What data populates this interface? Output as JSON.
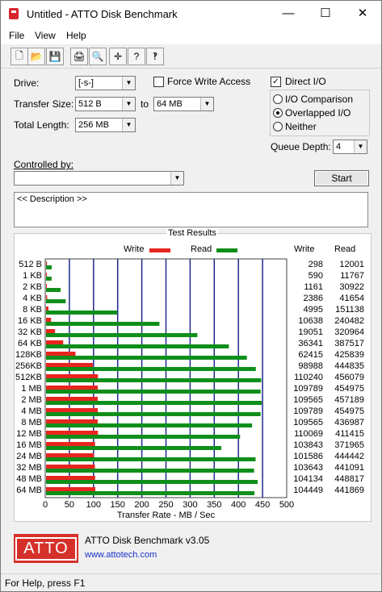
{
  "window": {
    "title": "Untitled - ATTO Disk Benchmark",
    "min": "—",
    "max": "☐",
    "close": "✕"
  },
  "menu": [
    "File",
    "View",
    "Help"
  ],
  "toolbar": [
    {
      "name": "new-icon",
      "glyph": "🗋"
    },
    {
      "name": "open-icon",
      "glyph": "📂"
    },
    {
      "name": "save-icon",
      "glyph": "💾"
    },
    {
      "name": "print-icon",
      "glyph": "🖨"
    },
    {
      "name": "print-preview-icon",
      "glyph": "🔍"
    },
    {
      "name": "move-icon",
      "glyph": "✛"
    },
    {
      "name": "help-icon",
      "glyph": "?"
    },
    {
      "name": "context-help-icon",
      "glyph": "‽"
    }
  ],
  "settings": {
    "drive_label": "Drive:",
    "drive_value": "[-s-]",
    "transfer_label": "Transfer Size:",
    "transfer_from": "512 B",
    "to_label": "to",
    "transfer_to": "64 MB",
    "total_label": "Total Length:",
    "total_value": "256 MB",
    "force_write": "Force Write Access",
    "force_write_checked": false,
    "direct_io": "Direct I/O",
    "direct_io_checked": true,
    "io_comparison": "I/O Comparison",
    "overlapped_io": "Overlapped I/O",
    "neither": "Neither",
    "selected_io": "overlapped",
    "queue_label": "Queue Depth:",
    "queue_value": "4",
    "controlled_label": "Controlled by:",
    "controlled_value": "",
    "start_label": "Start",
    "description": "<< Description >>"
  },
  "results_title": "Test Results",
  "legend": {
    "write": "Write",
    "read": "Read",
    "write_color": "#e8251f",
    "read_color": "#0f8f1a"
  },
  "columns": {
    "write": "Write",
    "read": "Read"
  },
  "chart_data": {
    "type": "bar",
    "xlabel": "Transfer Rate - MB / Sec",
    "xlim": [
      0,
      500
    ],
    "xticks": [
      "0",
      "50",
      "100",
      "150",
      "200",
      "250",
      "300",
      "350",
      "400",
      "450",
      "500"
    ],
    "categories": [
      "512 B",
      "1 KB",
      "2 KB",
      "4 KB",
      "8 KB",
      "16 KB",
      "32 KB",
      "64 KB",
      "128KB",
      "256KB",
      "512KB",
      "1 MB",
      "2 MB",
      "4 MB",
      "8 MB",
      "12 MB",
      "16 MB",
      "24 MB",
      "32 MB",
      "48 MB",
      "64 MB"
    ],
    "series": [
      {
        "name": "Write",
        "values": [
          0.29,
          0.58,
          1.13,
          2.33,
          4.88,
          10.38,
          18.6,
          35.49,
          60.95,
          96.67,
          107.49,
          107.22,
          106.99,
          107.22,
          106.99,
          107.49,
          101.41,
          99.2,
          101.21,
          101.69,
          102.0
        ],
        "labels": [
          "298",
          "590",
          "1161",
          "2386",
          "4995",
          "10638",
          "19051",
          "36341",
          "62415",
          "98988",
          "110240",
          "109789",
          "109565",
          "109789",
          "109565",
          "110069",
          "103843",
          "101586",
          "103643",
          "104134",
          "104449"
        ]
      },
      {
        "name": "Read",
        "values": [
          11.72,
          11.49,
          30.2,
          40.68,
          147.6,
          234.8,
          313.4,
          378.6,
          415.9,
          434.4,
          445.4,
          444.3,
          446.6,
          444.3,
          426.7,
          401.8,
          363.0,
          433.9,
          430.8,
          438.3,
          431.5
        ],
        "labels": [
          "12001",
          "11767",
          "30922",
          "41654",
          "151138",
          "240482",
          "320964",
          "387517",
          "425839",
          "444835",
          "456079",
          "454975",
          "457189",
          "454975",
          "436987",
          "411415",
          "371965",
          "444442",
          "441091",
          "448817",
          "441869"
        ]
      }
    ]
  },
  "footer": {
    "logo": "ATTO",
    "product": "ATTO Disk Benchmark v3.05",
    "url": "www.attotech.com"
  },
  "status": "For Help, press F1"
}
